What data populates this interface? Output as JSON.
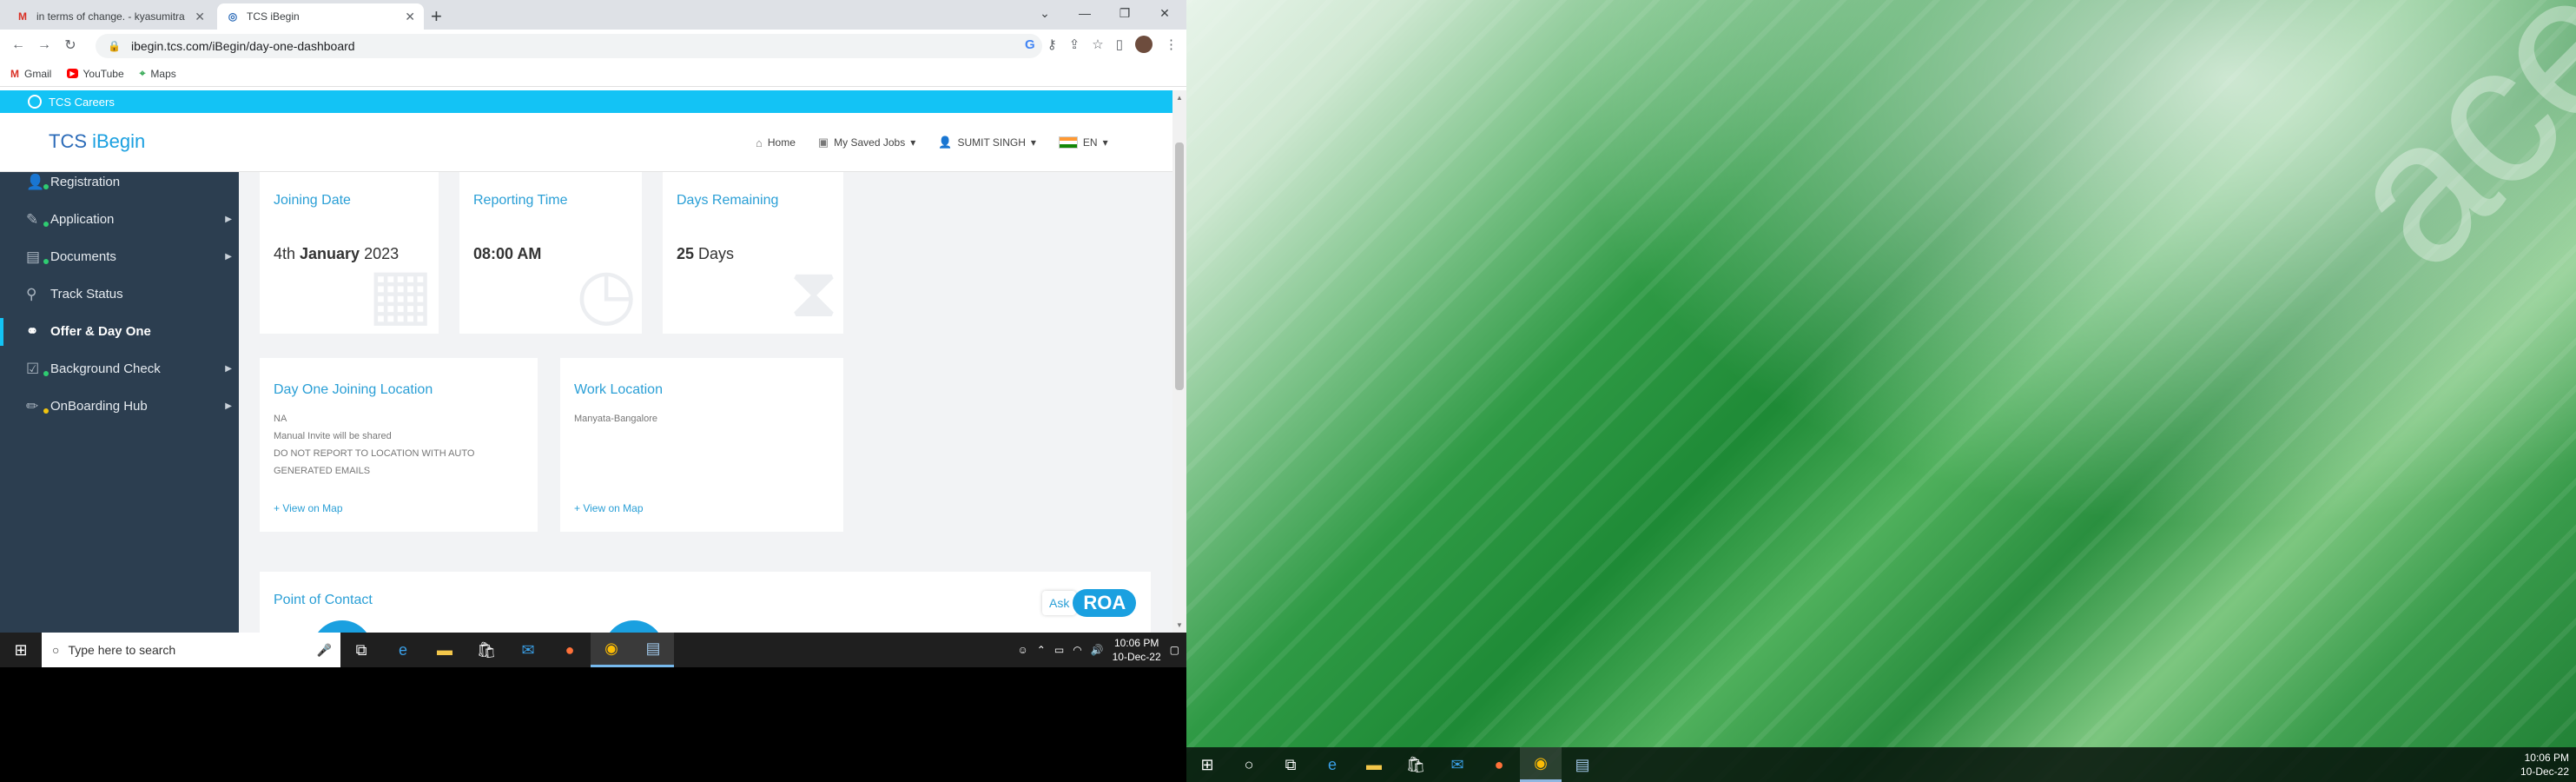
{
  "browser": {
    "tabs": [
      {
        "title": "in terms of change. - kyasumitra",
        "icon": "gmail-icon"
      },
      {
        "title": "TCS iBegin",
        "icon": "tcs-icon"
      }
    ],
    "url": "ibegin.tcs.com/iBegin/day-one-dashboard",
    "bookmarks": [
      {
        "label": "Gmail"
      },
      {
        "label": "YouTube"
      },
      {
        "label": "Maps"
      }
    ]
  },
  "page": {
    "careers_label": "TCS Careers",
    "logo_prefix": "TCS ",
    "logo_name": "iBegin",
    "nav": {
      "home": "Home",
      "saved_jobs": "My Saved Jobs",
      "user": "SUMIT SINGH",
      "language": "EN"
    },
    "sidebar": [
      {
        "label": "Registration",
        "dot": "#2ecc71"
      },
      {
        "label": "Application",
        "dot": "#2ecc71"
      },
      {
        "label": "Documents",
        "dot": "#2ecc71"
      },
      {
        "label": "Track Status",
        "dot": ""
      },
      {
        "label": "Offer & Day One",
        "dot": ""
      },
      {
        "label": "Background Check",
        "dot": "#2ecc71"
      },
      {
        "label": "OnBoarding Hub",
        "dot": "#f1c40f"
      }
    ],
    "cards": {
      "joining_date": {
        "title": "Joining Date",
        "value_pre": "4th ",
        "value_bold": "January",
        "value_post": " 2023"
      },
      "reporting_time": {
        "title": "Reporting Time",
        "value": "08:00 AM"
      },
      "days_remaining": {
        "title": "Days Remaining",
        "value_bold": "25",
        "value_post": " Days"
      },
      "joining_location": {
        "title": "Day One Joining Location",
        "line1": "NA",
        "line2": "Manual Invite will be shared",
        "line3": "DO NOT REPORT TO LOCATION WITH AUTO",
        "line4": "GENERATED EMAILS",
        "link": "+ View on Map"
      },
      "work_location": {
        "title": "Work Location",
        "line1": "Manyata-Bangalore",
        "link": "+ View on Map"
      },
      "point_of_contact": {
        "title": "Point of Contact"
      }
    },
    "ask": "Ask",
    "roa": "ROA"
  },
  "taskbar": {
    "search_placeholder": "Type here to search",
    "time": "10:06 PM",
    "date": "10-Dec-22"
  },
  "desktop": {
    "brand": "acer",
    "time": "10:06 PM",
    "date": "10-Dec-22"
  }
}
